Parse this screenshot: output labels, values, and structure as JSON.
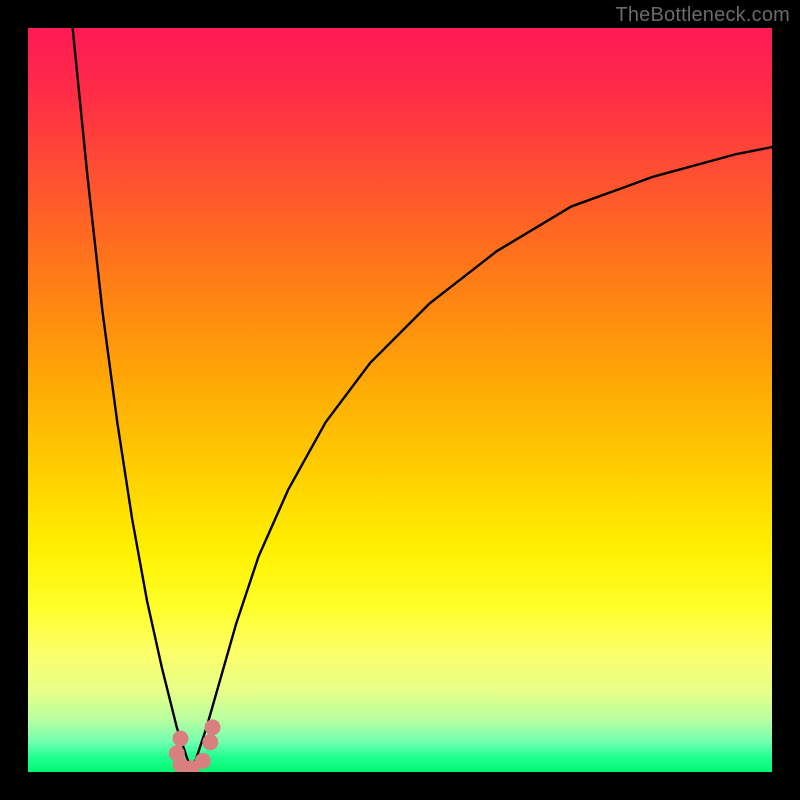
{
  "watermark": {
    "text": "TheBottleneck.com"
  },
  "palette": {
    "frame": "#000000",
    "curve": "#000000",
    "marker": "#d88080",
    "gradient_stops": [
      "#ff1a55",
      "#ff2a48",
      "#ff4a35",
      "#ff6a20",
      "#ff8a10",
      "#ffaa05",
      "#ffd000",
      "#fff000",
      "#ffff2a",
      "#fcff6a",
      "#e8ff88",
      "#b8ffa0",
      "#70ffb0",
      "#20ff90",
      "#00f770"
    ]
  },
  "chart_data": {
    "type": "line",
    "title": "",
    "xlabel": "",
    "ylabel": "",
    "xlim": [
      0,
      100
    ],
    "ylim": [
      0,
      100
    ],
    "grid": false,
    "legend": false,
    "note": "Two black curves descending into a V near x≈22; salmon markers cluster at the bottom of the V.",
    "series": [
      {
        "name": "left-branch",
        "x": [
          6,
          8,
          10,
          12,
          14,
          16,
          18,
          19,
          20,
          21,
          22
        ],
        "y": [
          100,
          80,
          62,
          47,
          34,
          23,
          14,
          10,
          6,
          3,
          0
        ]
      },
      {
        "name": "right-branch",
        "x": [
          22,
          24,
          26,
          28,
          31,
          35,
          40,
          46,
          54,
          63,
          73,
          84,
          95,
          100
        ],
        "y": [
          0,
          6,
          13,
          20,
          29,
          38,
          47,
          55,
          63,
          70,
          76,
          80,
          83,
          84
        ]
      }
    ],
    "markers": {
      "name": "marker-cluster",
      "points": [
        {
          "x": 20.5,
          "y": 4.5
        },
        {
          "x": 20.0,
          "y": 2.5
        },
        {
          "x": 20.5,
          "y": 1.0
        },
        {
          "x": 22.0,
          "y": 0.5
        },
        {
          "x": 23.5,
          "y": 1.5
        },
        {
          "x": 24.5,
          "y": 4.0
        },
        {
          "x": 24.8,
          "y": 6.0
        }
      ],
      "radius_px": 8
    }
  }
}
